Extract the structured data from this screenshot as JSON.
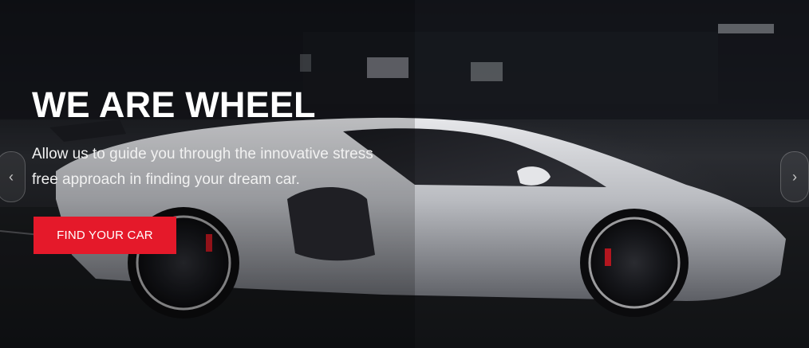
{
  "hero": {
    "title": "WE ARE WHEEL",
    "subtitle": "Allow us to guide you through the innovative stress free approach in finding your dream car.",
    "cta_label": "FIND YOUR CAR"
  },
  "carousel": {
    "prev_icon": "chevron-left-icon",
    "next_icon": "chevron-right-icon",
    "prev_glyph": "‹",
    "next_glyph": "›"
  },
  "colors": {
    "accent": "#e5192a",
    "text": "#ffffff",
    "background": "#0c0d10"
  }
}
